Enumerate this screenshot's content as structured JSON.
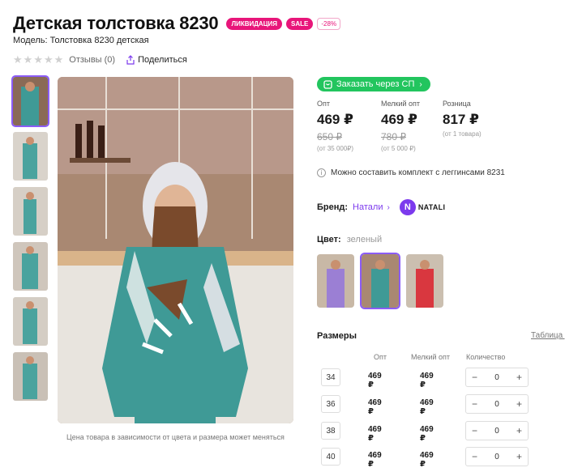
{
  "product": {
    "title": "Детская толстовка 8230",
    "badges": {
      "liquidation": "ЛИКВИДАЦИЯ",
      "sale": "SALE",
      "discount": "-28%"
    },
    "model": "Модель: Толстовка 8230 детская",
    "reviews": "Отзывы (0)",
    "share": "Поделиться"
  },
  "gallery": {
    "caption": "Цена товара в зависимости от цвета и размера может меняться"
  },
  "purchase": {
    "sp_button": "Заказать через СП",
    "prices": [
      {
        "label": "Опт",
        "price": "469 ₽",
        "old": "650 ₽",
        "note": "(от 35 000₽)"
      },
      {
        "label": "Мелкий опт",
        "price": "469 ₽",
        "old": "780 ₽",
        "note": "(от 5 000 ₽)"
      },
      {
        "label": "Розница",
        "price": "817 ₽",
        "old": "",
        "note": "(от 1 товара)"
      }
    ],
    "set_note": "Можно составить комплект с леггинсами 8231"
  },
  "brand": {
    "label": "Бренд:",
    "name": "Натали",
    "logo_letter": "N",
    "logo_text": "NATALI"
  },
  "color": {
    "label": "Цвет:",
    "value": "зеленый"
  },
  "sizes": {
    "title": "Размеры",
    "table_link": "Таблица р",
    "headers": {
      "opt": "Опт",
      "small_opt": "Мелкий опт",
      "qty": "Количество"
    },
    "rows": [
      {
        "size": "34",
        "opt": "469 ₽",
        "small_opt": "469 ₽",
        "qty": "0"
      },
      {
        "size": "36",
        "opt": "469 ₽",
        "small_opt": "469 ₽",
        "qty": "0"
      },
      {
        "size": "38",
        "opt": "469 ₽",
        "small_opt": "469 ₽",
        "qty": "0"
      },
      {
        "size": "40",
        "opt": "469 ₽",
        "small_opt": "469 ₽",
        "qty": "0"
      }
    ],
    "minus": "−",
    "plus": "+"
  },
  "colors": {
    "accent": "#8b5cf6",
    "pink": "#e8157a",
    "green": "#22c55e",
    "teal": "#3f9a96"
  }
}
